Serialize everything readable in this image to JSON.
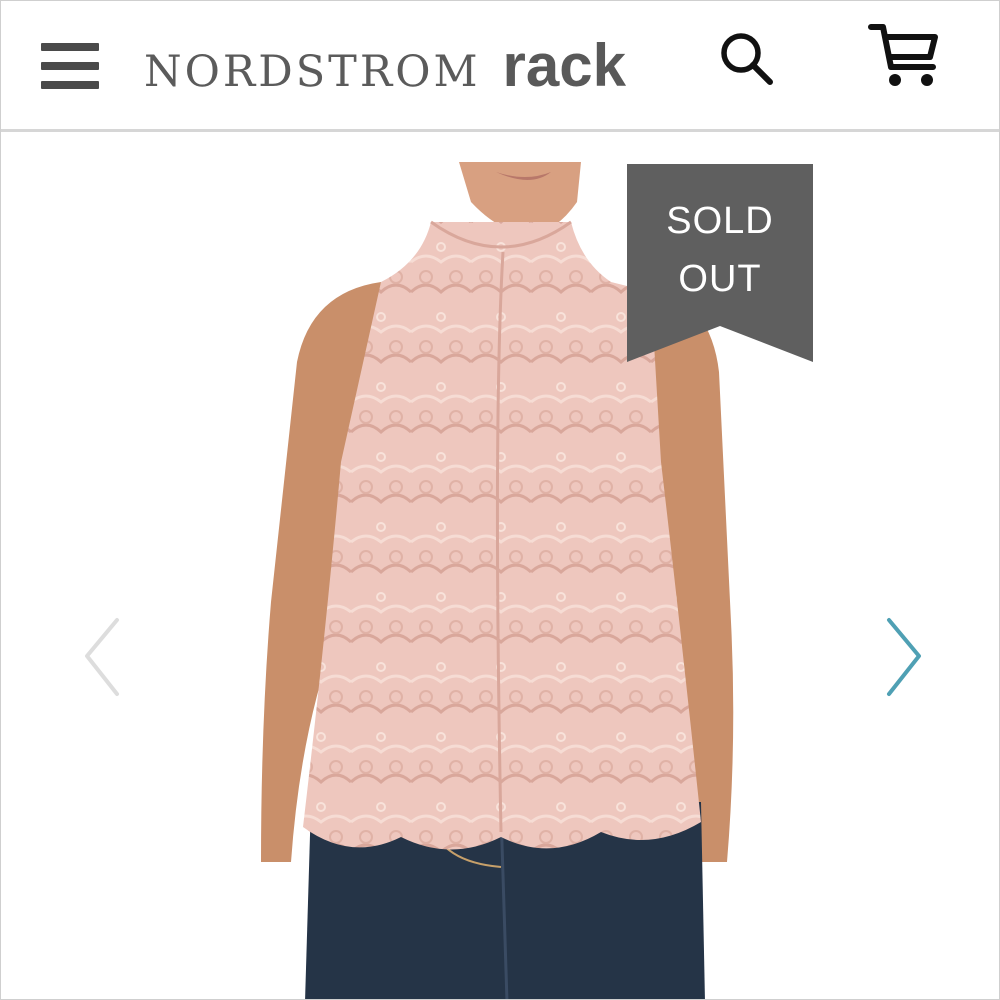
{
  "header": {
    "brand_primary": "NORDSTROM",
    "brand_secondary": "rack",
    "menu_icon": "hamburger-menu-icon",
    "search_icon": "search-icon",
    "cart_icon": "shopping-cart-icon"
  },
  "product": {
    "badge": {
      "line1": "SOLD",
      "line2": "OUT",
      "color": "#5f5f5f"
    },
    "image_colors": {
      "top": "#eec7be",
      "lace_shadow": "#d9a79b",
      "skin": "#c98f6a",
      "jeans": "#253447"
    },
    "carousel": {
      "prev_icon": "chevron-left-icon",
      "next_icon": "chevron-right-icon",
      "prev_color": "#dddddd",
      "next_color": "#4fa0b4"
    }
  }
}
